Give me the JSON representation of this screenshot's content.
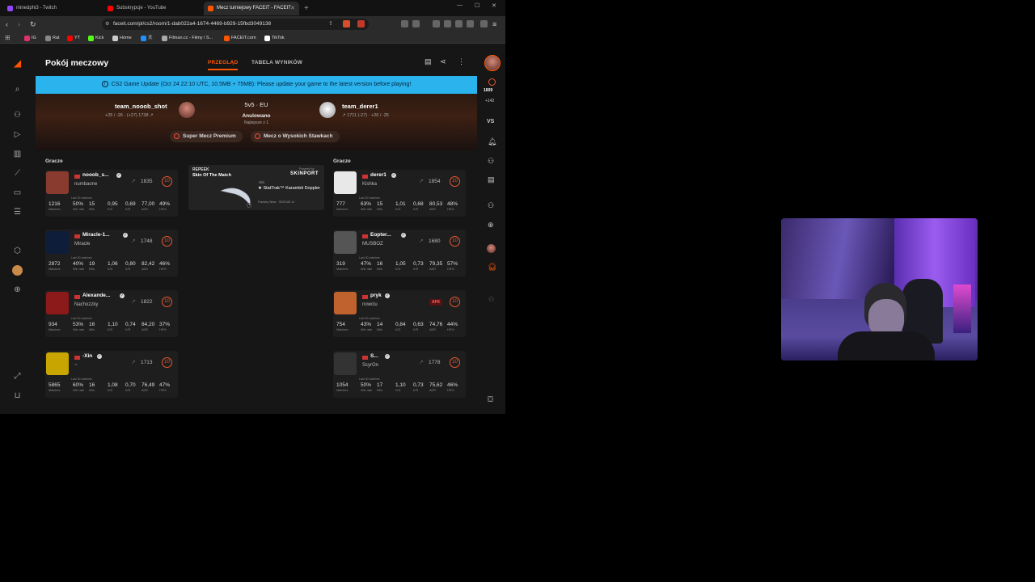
{
  "browser": {
    "tabs": [
      {
        "label": "minedphi3 - Twitch",
        "active": false,
        "icon_color": "#9146ff"
      },
      {
        "label": "Subskrypcje - YouTube",
        "active": false,
        "icon_color": "#ff0000"
      },
      {
        "label": "Mecz turniejowy FACEIT - FACEIT",
        "active": true,
        "icon_color": "#ff5500"
      }
    ],
    "url": "faceit.com/pl/cs2/room/1-dab022a4-1674-4469-b929-15fbd3049138",
    "bookmarks": [
      {
        "label": "IG",
        "color": "#e1306c"
      },
      {
        "label": "Rat",
        "color": "#888888"
      },
      {
        "label": "YT",
        "color": "#ff0000"
      },
      {
        "label": "Kick",
        "color": "#53fc18"
      },
      {
        "label": "Home",
        "color": "#cccccc"
      },
      {
        "label": "天",
        "color": "#1e90ff"
      },
      {
        "label": "Filman.cc - Filmy i S...",
        "color": "#aaaaaa"
      },
      {
        "label": "FACEIT.com",
        "color": "#ff5500"
      },
      {
        "label": "TikTok",
        "color": "#ffffff"
      }
    ]
  },
  "faceit": {
    "page_title": "Pokój meczowy",
    "tabs": [
      "PRZEGLĄD",
      "TABELA WYNIKÓW"
    ],
    "banner": "CS2 Game Update (Oct 24 22:10 UTC, 10.5MB + 75MB): Please update your game to the latest version before playing!",
    "match": {
      "mode": "5v5 · EU",
      "status": "Anulowano",
      "best_of": "Najlepsze z 1",
      "team1": {
        "name": "team_nooob_shot",
        "stats": "+25 / -26 · (+27) 1738 ↗"
      },
      "team2": {
        "name": "team_derer1",
        "stats": "↗ 1711 (-27) · +26 / -25"
      },
      "pills": [
        "Super Mecz Premium",
        "Mecz o Wysokich Stawkach"
      ]
    },
    "players_label": "Gracze",
    "skin": {
      "brand": "REPEEK",
      "title": "Skin Of The Match",
      "powered": "Powered by",
      "sponsor": "SKINPORT",
      "owner": "-Xin",
      "name": "★ StatTrak™ Karambit Doppler",
      "wear": "Factory New · 9929,82 zł"
    },
    "team1_players": [
      {
        "name": "nooob_s...",
        "nick": "numbaone",
        "elo": "1835",
        "level": "10",
        "stats": [
          "1216",
          "50%",
          "15",
          "0,95",
          "0,69",
          "77,00",
          "49%"
        ],
        "avatar_color": "#8a3b2f"
      },
      {
        "name": "Miracle-1...",
        "nick": "Miracle",
        "elo": "1748",
        "level": "10",
        "stats": [
          "2872",
          "40%",
          "19",
          "1,06",
          "0,80",
          "82,42",
          "46%"
        ],
        "avatar_color": "#0d1d3a"
      },
      {
        "name": "Alexande...",
        "nick": "Nachozzky",
        "elo": "1822",
        "level": "10",
        "stats": [
          "934",
          "53%",
          "16",
          "1,10",
          "0,74",
          "84,20",
          "37%"
        ],
        "avatar_color": "#8c1a1a"
      },
      {
        "name": "-Xin",
        "nick": "~",
        "elo": "1713",
        "level": "10",
        "stats": [
          "5865",
          "60%",
          "16",
          "1,08",
          "0,70",
          "76,49",
          "47%"
        ],
        "avatar_color": "#c8a500"
      }
    ],
    "team2_players": [
      {
        "name": "derer1",
        "nick": "Kishka",
        "elo": "1854",
        "level": "10",
        "stats": [
          "777",
          "63%",
          "15",
          "1,01",
          "0,68",
          "80,53",
          "48%"
        ],
        "avatar_color": "#e8e8e8"
      },
      {
        "name": "Eopter...",
        "nick": "MUSBOZ",
        "elo": "1680",
        "level": "10",
        "stats": [
          "319",
          "47%",
          "16",
          "1,05",
          "0,73",
          "79,35",
          "57%"
        ],
        "avatar_color": "#555555"
      },
      {
        "name": "pryk",
        "nick": "nowciu",
        "elo": "",
        "level": "10",
        "afk": "AFK",
        "stats": [
          "754",
          "43%",
          "14",
          "0,84",
          "0,63",
          "74,76",
          "44%"
        ],
        "avatar_color": "#c0622e"
      },
      {
        "name": "S...",
        "nick": "ScyrOn",
        "elo": "1778",
        "level": "10",
        "stats": [
          "1054",
          "50%",
          "17",
          "1,10",
          "0,73",
          "75,62",
          "46%"
        ],
        "avatar_color": "#333333"
      }
    ],
    "stat_labels": [
      "Matches",
      "Win rate",
      "Kills",
      "K/D",
      "K/R",
      "ADR",
      "HS%"
    ],
    "last_label": "Last 30 matches",
    "right_nav": {
      "elo": "1609",
      "elo_diff": "+142",
      "vs": "VS"
    }
  },
  "colors": {
    "accent": "#ff5500",
    "banner": "#2bb3ee",
    "bg": "#161616"
  }
}
